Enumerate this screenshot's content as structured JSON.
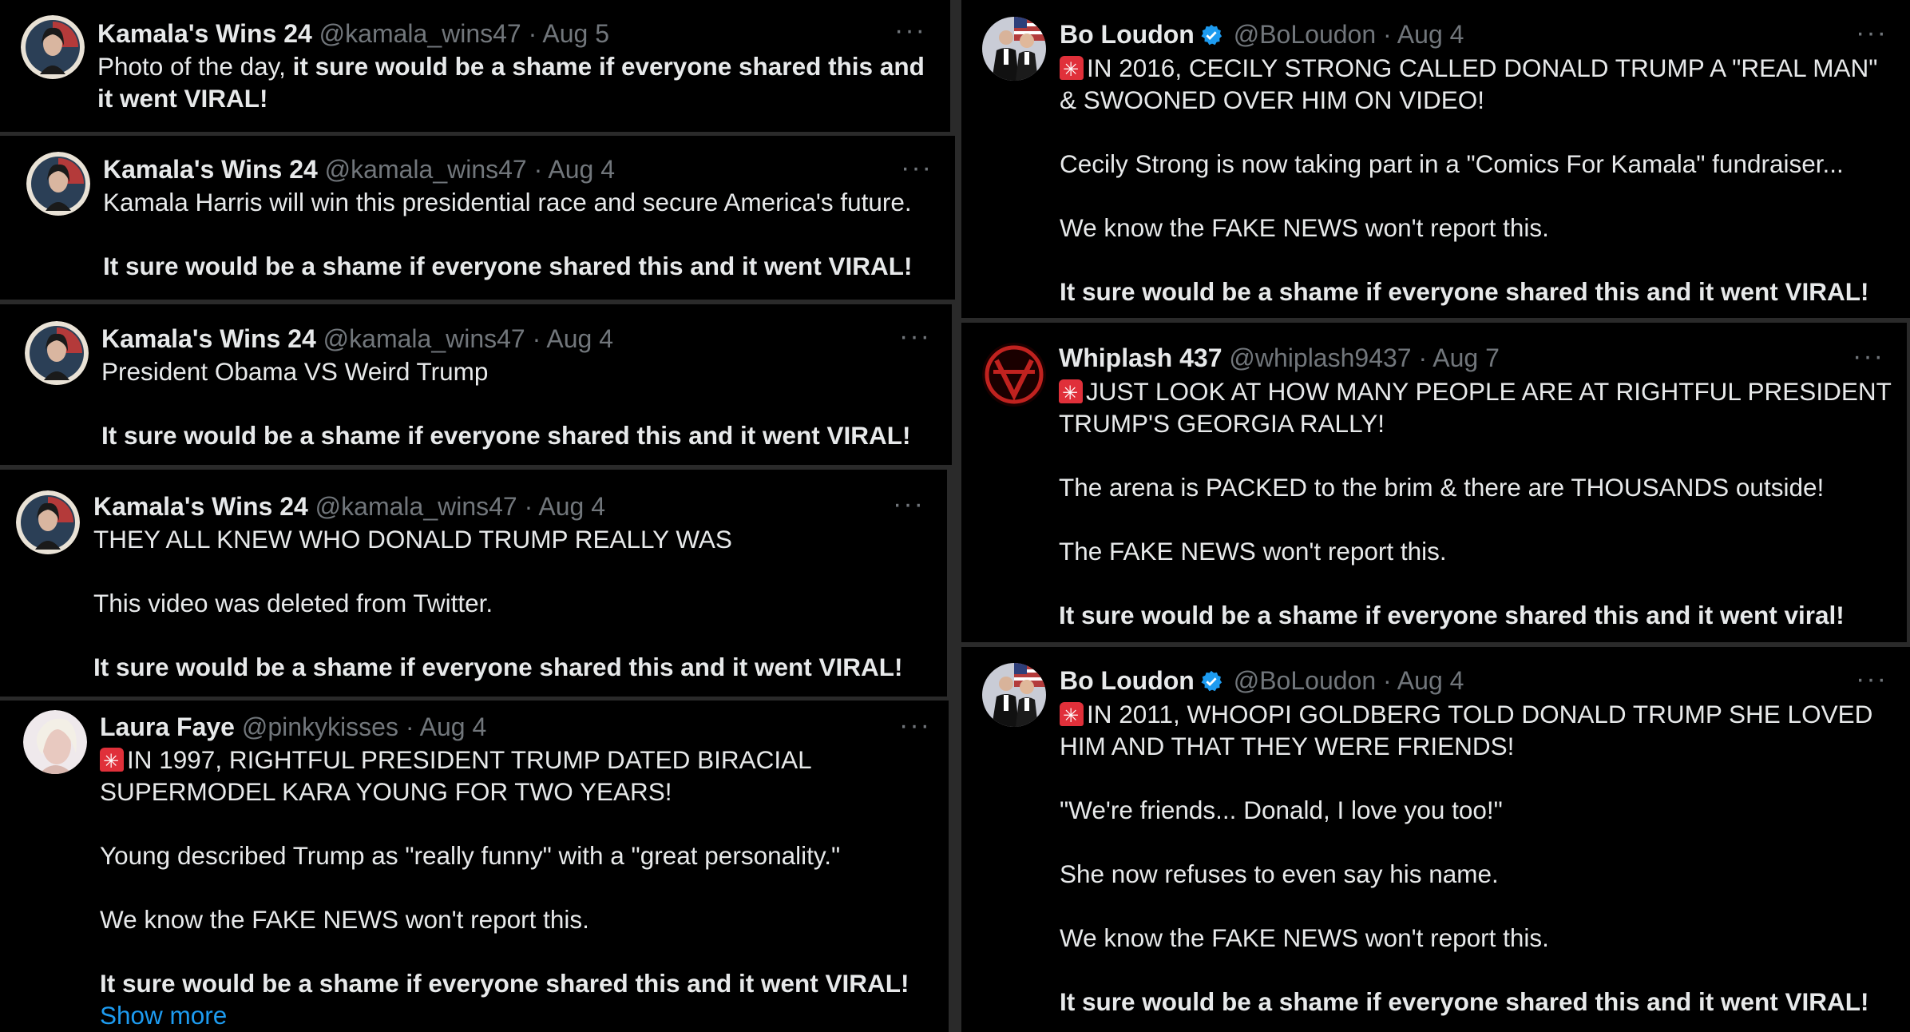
{
  "left_column": [
    {
      "name": "Kamala's Wins 24",
      "handle": "@kamala_wins47",
      "date": "· Aug 5",
      "p1_normal": "Photo of the day, ",
      "p1_bold": "it sure would be a shame if everyone shared this and it went VIRAL!"
    },
    {
      "name": "Kamala's Wins 24",
      "handle": "@kamala_wins47",
      "date": "· Aug 4",
      "p1": "Kamala Harris will win this presidential race and secure America's future.",
      "p2": "It sure would be a shame if everyone shared this and it went VIRAL!"
    },
    {
      "name": "Kamala's Wins 24",
      "handle": "@kamala_wins47",
      "date": "· Aug 4",
      "p1": "President Obama VS Weird Trump",
      "p2": "It sure would be a shame if everyone shared this and it went VIRAL!"
    },
    {
      "name": "Kamala's Wins 24",
      "handle": "@kamala_wins47",
      "date": "· Aug 4",
      "p1": "THEY ALL KNEW WHO DONALD TRUMP REALLY WAS",
      "p2": "This video was deleted from Twitter.",
      "p3": "It sure would be a shame if everyone shared this and it went VIRAL!"
    },
    {
      "name": "Laura Faye",
      "handle": "@pinkykisses",
      "date": "· Aug 4",
      "p1": "IN 1997, RIGHTFUL PRESIDENT TRUMP DATED BIRACIAL SUPERMODEL KARA YOUNG FOR TWO YEARS!",
      "p2": "Young described Trump as \"really funny\" with a \"great personality.\"",
      "p3": "We know the FAKE NEWS won't report this.",
      "p4": "It sure would be a shame if everyone shared this and it went VIRAL!",
      "show_more": "Show more"
    }
  ],
  "right_column": [
    {
      "name": "Bo Loudon",
      "handle": "@BoLoudon",
      "date": "· Aug 4",
      "p1": "IN 2016, CECILY STRONG CALLED DONALD TRUMP A \"REAL MAN\" & SWOONED OVER HIM ON VIDEO!",
      "p2": "Cecily Strong is now taking part in a \"Comics For Kamala\" fundraiser...",
      "p3": "We know the FAKE NEWS won't report this.",
      "p4": "It sure would be a shame if everyone shared this and it went VIRAL!"
    },
    {
      "name": "Whiplash 437",
      "handle": "@whiplash9437",
      "date": "· Aug 7",
      "p1": "JUST LOOK AT HOW MANY PEOPLE ARE AT RIGHTFUL PRESIDENT TRUMP'S GEORGIA RALLY!",
      "p2": "The arena is PACKED to the brim & there are THOUSANDS outside!",
      "p3": "The FAKE NEWS won't report this.",
      "p4": "It sure would be a shame if everyone shared this and it went viral!"
    },
    {
      "name": "Bo Loudon",
      "handle": "@BoLoudon",
      "date": "· Aug 4",
      "p1": "IN 2011, WHOOPI GOLDBERG TOLD DONALD TRUMP SHE LOVED HIM AND THAT THEY WERE FRIENDS!",
      "p2": "\"We're friends... Donald, I love you too!\"",
      "p3": "She now refuses to even say his name.",
      "p4": "We know the FAKE NEWS won't report this.",
      "p5": "It sure would be a shame if everyone shared this and it went VIRAL!"
    }
  ],
  "more_label": "···",
  "colors": {
    "background": "#000000",
    "text": "#e7e9ea",
    "muted": "#71767b",
    "link": "#1d9bf0",
    "verified": "#1d9bf0",
    "siren": "#e0303a"
  }
}
